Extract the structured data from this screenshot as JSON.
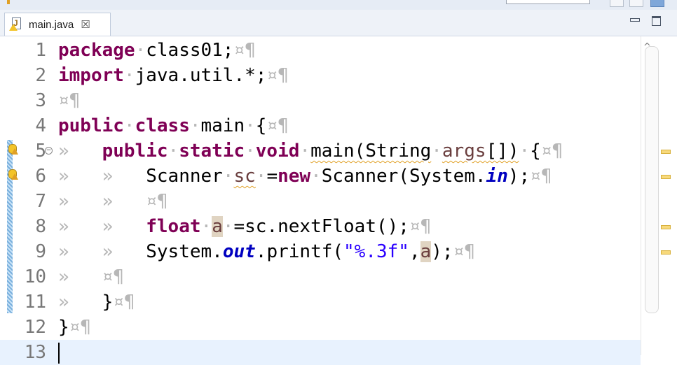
{
  "tab": {
    "file_name": "main.java",
    "close_glyph": "☒"
  },
  "window_controls": {
    "minimize_icon": "minimize-icon",
    "maximize_icon": "maximize-icon"
  },
  "editor": {
    "lines": [
      {
        "num": "1",
        "tokens": [
          {
            "t": "package",
            "c": "kw"
          },
          {
            "t": "·",
            "c": "ws"
          },
          {
            "t": "class01;",
            "c": ""
          },
          {
            "t": "¤¶",
            "c": "ws"
          }
        ]
      },
      {
        "num": "2",
        "tokens": [
          {
            "t": "import",
            "c": "kw"
          },
          {
            "t": "·",
            "c": "ws"
          },
          {
            "t": "java.util.*;",
            "c": ""
          },
          {
            "t": "¤¶",
            "c": "ws"
          }
        ]
      },
      {
        "num": "3",
        "tokens": [
          {
            "t": "¤¶",
            "c": "ws"
          }
        ]
      },
      {
        "num": "4",
        "tokens": [
          {
            "t": "public",
            "c": "kw"
          },
          {
            "t": "·",
            "c": "ws"
          },
          {
            "t": "class",
            "c": "kw"
          },
          {
            "t": "·",
            "c": "ws"
          },
          {
            "t": "main",
            "c": ""
          },
          {
            "t": "·",
            "c": "ws"
          },
          {
            "t": "{",
            "c": ""
          },
          {
            "t": "¤¶",
            "c": "ws"
          }
        ]
      },
      {
        "num": "5",
        "tokens": [
          {
            "t": "»   ",
            "c": "ws"
          },
          {
            "t": "public",
            "c": "kw"
          },
          {
            "t": "·",
            "c": "ws"
          },
          {
            "t": "static",
            "c": "kw"
          },
          {
            "t": "·",
            "c": "ws"
          },
          {
            "t": "void",
            "c": "kw"
          },
          {
            "t": "·",
            "c": "ws"
          },
          {
            "t": "main(String",
            "c": "squig"
          },
          {
            "t": "·",
            "c": "ws"
          },
          {
            "t": "args",
            "c": "var squig"
          },
          {
            "t": "[])",
            "c": "squig"
          },
          {
            "t": "·",
            "c": "ws"
          },
          {
            "t": "{",
            "c": ""
          },
          {
            "t": "¤¶",
            "c": "ws"
          }
        ]
      },
      {
        "num": "6",
        "tokens": [
          {
            "t": "»   ",
            "c": "ws"
          },
          {
            "t": "»   ",
            "c": "ws"
          },
          {
            "t": "Scanner",
            "c": ""
          },
          {
            "t": "·",
            "c": "ws"
          },
          {
            "t": "sc",
            "c": "var squig"
          },
          {
            "t": "·",
            "c": "ws"
          },
          {
            "t": "=",
            "c": ""
          },
          {
            "t": "new",
            "c": "kw"
          },
          {
            "t": "·",
            "c": "ws"
          },
          {
            "t": "Scanner(System.",
            "c": ""
          },
          {
            "t": "in",
            "c": "fld"
          },
          {
            "t": ");",
            "c": ""
          },
          {
            "t": "¤¶",
            "c": "ws"
          }
        ]
      },
      {
        "num": "7",
        "tokens": [
          {
            "t": "»   ",
            "c": "ws"
          },
          {
            "t": "»   ",
            "c": "ws"
          },
          {
            "t": "¤¶",
            "c": "ws"
          }
        ]
      },
      {
        "num": "8",
        "tokens": [
          {
            "t": "»   ",
            "c": "ws"
          },
          {
            "t": "»   ",
            "c": "ws"
          },
          {
            "t": "float",
            "c": "kw"
          },
          {
            "t": "·",
            "c": "ws"
          },
          {
            "t": "a",
            "c": "var hl"
          },
          {
            "t": "·",
            "c": "ws"
          },
          {
            "t": "=sc.nextFloat();",
            "c": ""
          },
          {
            "t": "¤¶",
            "c": "ws"
          }
        ]
      },
      {
        "num": "9",
        "tokens": [
          {
            "t": "»   ",
            "c": "ws"
          },
          {
            "t": "»   ",
            "c": "ws"
          },
          {
            "t": "System.",
            "c": ""
          },
          {
            "t": "out",
            "c": "fld"
          },
          {
            "t": ".printf(",
            "c": ""
          },
          {
            "t": "\"%.3f\"",
            "c": "str"
          },
          {
            "t": ",",
            "c": ""
          },
          {
            "t": "a",
            "c": "var hl"
          },
          {
            "t": ");",
            "c": ""
          },
          {
            "t": "¤¶",
            "c": "ws"
          }
        ]
      },
      {
        "num": "10",
        "tokens": [
          {
            "t": "»   ",
            "c": "ws"
          },
          {
            "t": "¤¶",
            "c": "ws"
          }
        ]
      },
      {
        "num": "11",
        "tokens": [
          {
            "t": "»   ",
            "c": "ws"
          },
          {
            "t": "}",
            "c": ""
          },
          {
            "t": "¤¶",
            "c": "ws"
          }
        ]
      },
      {
        "num": "12",
        "tokens": [
          {
            "t": "}",
            "c": ""
          },
          {
            "t": "¤¶",
            "c": "ws"
          }
        ]
      },
      {
        "num": "13",
        "tokens": []
      }
    ],
    "colors": {
      "keyword": "#7f0055",
      "string": "#2a00ff",
      "field": "#0000c0",
      "whitespace_marker": "#b7b7b7",
      "current_line": "#e8f2fe"
    }
  }
}
